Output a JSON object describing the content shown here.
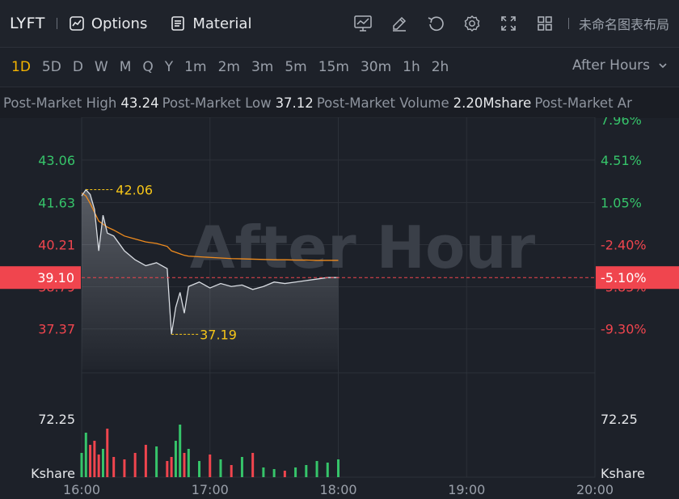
{
  "toolbar": {
    "symbol": "LYFT",
    "options_label": "Options",
    "material_label": "Material",
    "layout_name": "未命名图表布局",
    "icons": [
      "chart-type-icon",
      "draw-icon",
      "undo-icon",
      "settings-icon",
      "fullscreen-icon",
      "layout-grid-icon"
    ]
  },
  "periods": [
    "1D",
    "5D",
    "D",
    "W",
    "M",
    "Q",
    "Y",
    "1m",
    "2m",
    "3m",
    "5m",
    "15m",
    "30m",
    "1h",
    "2h"
  ],
  "active_period": "1D",
  "session": {
    "label": "After Hours"
  },
  "stats": [
    {
      "label": "Post-Market High",
      "value": "43.24"
    },
    {
      "label": "Post-Market Low",
      "value": "37.12"
    },
    {
      "label": "Post-Market Volume",
      "value": "2.20Mshare"
    },
    {
      "label": "Post-Market Ar",
      "value": ""
    }
  ],
  "chart": {
    "watermark": "After Hour",
    "price_labels": [
      "43.06",
      "41.63",
      "40.21",
      "38.79",
      "37.37"
    ],
    "pct_labels": [
      "7.96%",
      "4.51%",
      "1.05%",
      "-2.40%",
      "-5.85%",
      "-9.30%"
    ],
    "current_price": "39.10",
    "current_pct": "-5.10%",
    "high_marker": "42.06",
    "low_marker": "37.19",
    "volume_label": "72.25",
    "volume_unit": "Kshare",
    "time_labels": [
      "16:00",
      "17:00",
      "18:00",
      "19:00",
      "20:00"
    ],
    "colors": {
      "up": "#36c46a",
      "down": "#f0454e",
      "avg": "#f08c1e",
      "marker": "#f5c518",
      "grid": "#2c3139",
      "price": "#d8dce2"
    }
  },
  "chart_data": {
    "type": "line",
    "title": "",
    "x": [
      "16:00",
      "16:02",
      "16:04",
      "16:06",
      "16:08",
      "16:10",
      "16:12",
      "16:15",
      "16:20",
      "16:25",
      "16:30",
      "16:35",
      "16:40",
      "16:42",
      "16:44",
      "16:46",
      "16:48",
      "16:50",
      "16:55",
      "17:00",
      "17:05",
      "17:10",
      "17:15",
      "17:20",
      "17:25",
      "17:30",
      "17:35",
      "17:40",
      "17:45",
      "17:50",
      "17:55",
      "18:00"
    ],
    "series": [
      {
        "values": [
          41.85,
          42.06,
          41.9,
          41.4,
          40.0,
          41.2,
          40.6,
          40.5,
          40.0,
          39.7,
          39.5,
          39.6,
          39.4,
          37.19,
          38.1,
          38.6,
          37.9,
          38.8,
          38.95,
          38.75,
          38.9,
          38.8,
          38.85,
          38.7,
          38.8,
          38.95,
          38.9,
          38.95,
          39.0,
          39.05,
          39.1,
          39.1
        ]
      },
      {
        "values": [
          41.95,
          41.85,
          41.6,
          41.3,
          41.0,
          40.9,
          40.8,
          40.7,
          40.5,
          40.4,
          40.3,
          40.25,
          40.15,
          40.0,
          39.95,
          39.9,
          39.85,
          39.82,
          39.8,
          39.78,
          39.76,
          39.74,
          39.73,
          39.72,
          39.71,
          39.7,
          39.7,
          39.69,
          39.69,
          39.68,
          39.68,
          39.68
        ]
      }
    ],
    "ylim": [
      36.0,
      44.5
    ],
    "y_ticks": [
      43.06,
      41.63,
      40.21,
      38.79,
      37.37
    ],
    "volume_values": [
      30,
      55,
      40,
      45,
      28,
      35,
      60,
      25,
      22,
      30,
      40,
      38,
      20,
      25,
      45,
      65,
      30,
      35,
      20,
      28,
      22,
      15,
      25,
      30,
      12,
      10,
      8,
      12,
      15,
      20,
      18,
      22
    ],
    "volume_ylim": [
      0,
      125
    ],
    "volume_tick": 72.25,
    "grid": true
  }
}
